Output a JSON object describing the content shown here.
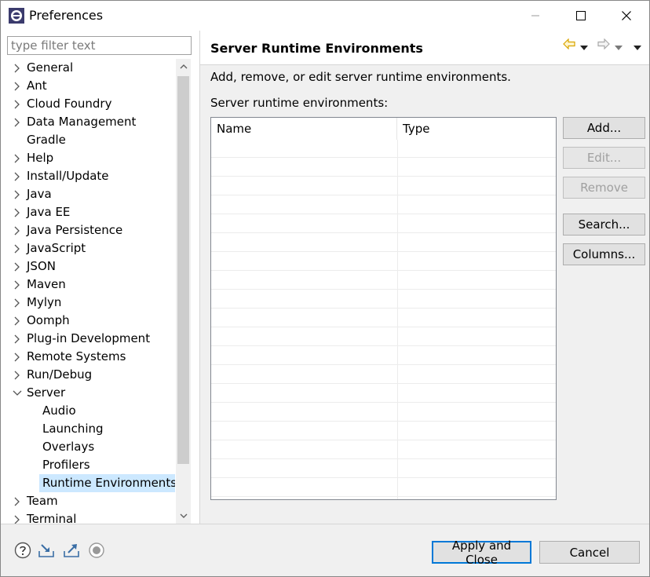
{
  "window": {
    "title": "Preferences"
  },
  "filter": {
    "placeholder": "type filter text",
    "value": ""
  },
  "tree": {
    "items": [
      {
        "label": "General",
        "level": 0,
        "expandable": true
      },
      {
        "label": "Ant",
        "level": 0,
        "expandable": true
      },
      {
        "label": "Cloud Foundry",
        "level": 0,
        "expandable": true
      },
      {
        "label": "Data Management",
        "level": 0,
        "expandable": true
      },
      {
        "label": "Gradle",
        "level": 0,
        "expandable": false
      },
      {
        "label": "Help",
        "level": 0,
        "expandable": true
      },
      {
        "label": "Install/Update",
        "level": 0,
        "expandable": true
      },
      {
        "label": "Java",
        "level": 0,
        "expandable": true
      },
      {
        "label": "Java EE",
        "level": 0,
        "expandable": true
      },
      {
        "label": "Java Persistence",
        "level": 0,
        "expandable": true
      },
      {
        "label": "JavaScript",
        "level": 0,
        "expandable": true
      },
      {
        "label": "JSON",
        "level": 0,
        "expandable": true
      },
      {
        "label": "Maven",
        "level": 0,
        "expandable": true
      },
      {
        "label": "Mylyn",
        "level": 0,
        "expandable": true
      },
      {
        "label": "Oomph",
        "level": 0,
        "expandable": true
      },
      {
        "label": "Plug-in Development",
        "level": 0,
        "expandable": true
      },
      {
        "label": "Remote Systems",
        "level": 0,
        "expandable": true
      },
      {
        "label": "Run/Debug",
        "level": 0,
        "expandable": true
      },
      {
        "label": "Server",
        "level": 0,
        "expandable": true,
        "expanded": true
      },
      {
        "label": "Audio",
        "level": 1,
        "expandable": false
      },
      {
        "label": "Launching",
        "level": 1,
        "expandable": false
      },
      {
        "label": "Overlays",
        "level": 1,
        "expandable": false
      },
      {
        "label": "Profilers",
        "level": 1,
        "expandable": false
      },
      {
        "label": "Runtime Environments",
        "level": 1,
        "expandable": false,
        "selected": true
      },
      {
        "label": "Team",
        "level": 0,
        "expandable": true
      },
      {
        "label": "Terminal",
        "level": 0,
        "expandable": true
      }
    ]
  },
  "page": {
    "title": "Server Runtime Environments",
    "description": "Add, remove, or edit server runtime environments.",
    "list_label": "Server runtime environments:"
  },
  "table": {
    "columns": [
      "Name",
      "Type"
    ],
    "rows": []
  },
  "buttons": {
    "add": "Add...",
    "edit": "Edit...",
    "remove": "Remove",
    "search": "Search...",
    "columns": "Columns..."
  },
  "footer": {
    "apply_close": "Apply and Close",
    "cancel": "Cancel"
  },
  "colors": {
    "selection": "#cce8ff",
    "accent": "#0078d7",
    "back_arrow": "#d9a400"
  }
}
